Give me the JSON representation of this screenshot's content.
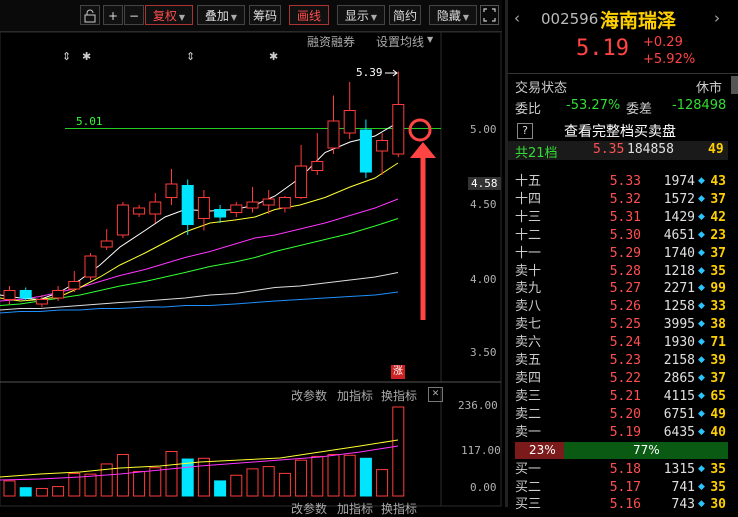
{
  "toolbar": {
    "items": [
      {
        "label": "",
        "kind": "lock-icon"
      },
      {
        "label": "+",
        "kind": "text"
      },
      {
        "label": "−",
        "kind": "text"
      },
      {
        "label": "复权",
        "kind": "dropdown",
        "active": true
      },
      {
        "label": "叠加",
        "kind": "dropdown"
      },
      {
        "label": "筹码",
        "kind": "text"
      },
      {
        "label": "画线",
        "kind": "text",
        "active": true
      },
      {
        "label": "显示",
        "kind": "dropdown"
      },
      {
        "label": "简约",
        "kind": "text"
      },
      {
        "label": "隐藏",
        "kind": "dropdown"
      }
    ],
    "fullscreen_icon": "fullscreen-icon"
  },
  "chart": {
    "links_top": [
      "融资融券",
      "设置均线"
    ],
    "ma_label": "5.01",
    "high_label": "5.39",
    "current_price_tag": "4.58",
    "y_ticks": [
      "5.00",
      "4.50",
      "4.00",
      "3.50"
    ],
    "limit_badge": "涨",
    "vol_links": [
      "改参数",
      "加指标",
      "换指标"
    ],
    "vol_y_ticks": [
      "236.00",
      "117.00",
      "0.00"
    ],
    "bottom_links": [
      "改参数",
      "加指标",
      "换指标"
    ],
    "colors": {
      "up": "#ff3b3b",
      "down": "#00e5ff",
      "ma5": "#ffffff",
      "ma10": "#ffff33",
      "ma20": "#ff33ff",
      "ma30": "#33ff33",
      "ma60": "#ffffff",
      "ma120": "#1e90ff",
      "annotation": "#ff4444"
    }
  },
  "chart_data": {
    "type": "candlestick",
    "ylim": [
      3.3,
      5.55
    ],
    "candles": [
      {
        "o": 3.87,
        "c": 3.93,
        "h": 3.96,
        "l": 3.84,
        "up": true
      },
      {
        "o": 3.93,
        "c": 3.88,
        "h": 3.95,
        "l": 3.86,
        "up": false
      },
      {
        "o": 3.84,
        "c": 3.87,
        "h": 3.9,
        "l": 3.82,
        "up": true
      },
      {
        "o": 3.88,
        "c": 3.93,
        "h": 3.96,
        "l": 3.86,
        "up": true
      },
      {
        "o": 3.94,
        "c": 3.99,
        "h": 4.06,
        "l": 3.92,
        "up": true
      },
      {
        "o": 4.02,
        "c": 4.16,
        "h": 4.18,
        "l": 4.0,
        "up": true
      },
      {
        "o": 4.22,
        "c": 4.26,
        "h": 4.34,
        "l": 4.2,
        "up": true
      },
      {
        "o": 4.3,
        "c": 4.5,
        "h": 4.52,
        "l": 4.28,
        "up": true
      },
      {
        "o": 4.44,
        "c": 4.48,
        "h": 4.5,
        "l": 4.42,
        "up": true
      },
      {
        "o": 4.44,
        "c": 4.52,
        "h": 4.58,
        "l": 4.38,
        "up": true
      },
      {
        "o": 4.55,
        "c": 4.64,
        "h": 4.74,
        "l": 4.5,
        "up": true
      },
      {
        "o": 4.63,
        "c": 4.37,
        "h": 4.67,
        "l": 4.3,
        "up": false
      },
      {
        "o": 4.41,
        "c": 4.55,
        "h": 4.6,
        "l": 4.33,
        "up": true
      },
      {
        "o": 4.47,
        "c": 4.42,
        "h": 4.5,
        "l": 4.38,
        "up": false
      },
      {
        "o": 4.45,
        "c": 4.5,
        "h": 4.52,
        "l": 4.42,
        "up": true
      },
      {
        "o": 4.48,
        "c": 4.52,
        "h": 4.62,
        "l": 4.45,
        "up": true
      },
      {
        "o": 4.5,
        "c": 4.54,
        "h": 4.6,
        "l": 4.44,
        "up": true
      },
      {
        "o": 4.48,
        "c": 4.55,
        "h": 4.56,
        "l": 4.45,
        "up": true
      },
      {
        "o": 4.55,
        "c": 4.76,
        "h": 4.9,
        "l": 4.54,
        "up": true
      },
      {
        "o": 4.73,
        "c": 4.79,
        "h": 4.98,
        "l": 4.7,
        "up": true
      },
      {
        "o": 4.88,
        "c": 5.06,
        "h": 5.23,
        "l": 4.84,
        "up": true
      },
      {
        "o": 4.98,
        "c": 5.13,
        "h": 5.32,
        "l": 4.94,
        "up": true
      },
      {
        "o": 5.0,
        "c": 4.72,
        "h": 5.07,
        "l": 4.68,
        "up": false
      },
      {
        "o": 4.86,
        "c": 4.93,
        "h": 4.98,
        "l": 4.7,
        "up": true
      },
      {
        "o": 4.84,
        "c": 5.17,
        "h": 5.39,
        "l": 4.82,
        "up": true
      }
    ],
    "volume": [
      {
        "v": 40,
        "up": true
      },
      {
        "v": 22,
        "up": false
      },
      {
        "v": 20,
        "up": true
      },
      {
        "v": 25,
        "up": true
      },
      {
        "v": 60,
        "up": true
      },
      {
        "v": 58,
        "up": true
      },
      {
        "v": 85,
        "up": true
      },
      {
        "v": 110,
        "up": true
      },
      {
        "v": 65,
        "up": true
      },
      {
        "v": 75,
        "up": true
      },
      {
        "v": 118,
        "up": true
      },
      {
        "v": 98,
        "up": false
      },
      {
        "v": 100,
        "up": true
      },
      {
        "v": 40,
        "up": false
      },
      {
        "v": 55,
        "up": true
      },
      {
        "v": 72,
        "up": true
      },
      {
        "v": 78,
        "up": true
      },
      {
        "v": 60,
        "up": true
      },
      {
        "v": 95,
        "up": true
      },
      {
        "v": 105,
        "up": true
      },
      {
        "v": 110,
        "up": true
      },
      {
        "v": 108,
        "up": true
      },
      {
        "v": 100,
        "up": false
      },
      {
        "v": 70,
        "up": true
      },
      {
        "v": 236,
        "up": true
      }
    ]
  },
  "panel": {
    "code": "002596",
    "name": "海南瑞泽",
    "price": "5.19",
    "change": "+0.29",
    "change_pct": "+5.92%",
    "status_label": "交易状态",
    "status_value": "休市",
    "weibi_label": "委比",
    "weibi_value": "-53.27%",
    "weicha_label": "委差",
    "weicha_value": "-128498",
    "help_label": "?",
    "full_book": "查看完整档买卖盘",
    "total_label": "共21档",
    "total_price": "5.35",
    "total_vol": "184858",
    "total_cnt": "49",
    "sell": [
      {
        "lbl": "十五",
        "p": "5.33",
        "v": "1974",
        "n": "43"
      },
      {
        "lbl": "十四",
        "p": "5.32",
        "v": "1572",
        "n": "37"
      },
      {
        "lbl": "十三",
        "p": "5.31",
        "v": "1429",
        "n": "42"
      },
      {
        "lbl": "十二",
        "p": "5.30",
        "v": "4651",
        "n": "23"
      },
      {
        "lbl": "十一",
        "p": "5.29",
        "v": "1740",
        "n": "37"
      },
      {
        "lbl": "卖十",
        "p": "5.28",
        "v": "1218",
        "n": "35"
      },
      {
        "lbl": "卖九",
        "p": "5.27",
        "v": "2271",
        "n": "99"
      },
      {
        "lbl": "卖八",
        "p": "5.26",
        "v": "1258",
        "n": "33"
      },
      {
        "lbl": "卖七",
        "p": "5.25",
        "v": "3995",
        "n": "38"
      },
      {
        "lbl": "卖六",
        "p": "5.24",
        "v": "1930",
        "n": "71"
      },
      {
        "lbl": "卖五",
        "p": "5.23",
        "v": "2158",
        "n": "39"
      },
      {
        "lbl": "卖四",
        "p": "5.22",
        "v": "2865",
        "n": "37"
      },
      {
        "lbl": "卖三",
        "p": "5.21",
        "v": "4115",
        "n": "65"
      },
      {
        "lbl": "卖二",
        "p": "5.20",
        "v": "6751",
        "n": "49"
      },
      {
        "lbl": "卖一",
        "p": "5.19",
        "v": "6435",
        "n": "40"
      }
    ],
    "ratio_left": "23%",
    "ratio_right": "77%",
    "ratio_fill": 0.23,
    "buy": [
      {
        "lbl": "买一",
        "p": "5.18",
        "v": "1315",
        "n": "35"
      },
      {
        "lbl": "买二",
        "p": "5.17",
        "v": "741",
        "n": "35"
      },
      {
        "lbl": "买三",
        "p": "5.16",
        "v": "743",
        "n": "30"
      }
    ]
  }
}
